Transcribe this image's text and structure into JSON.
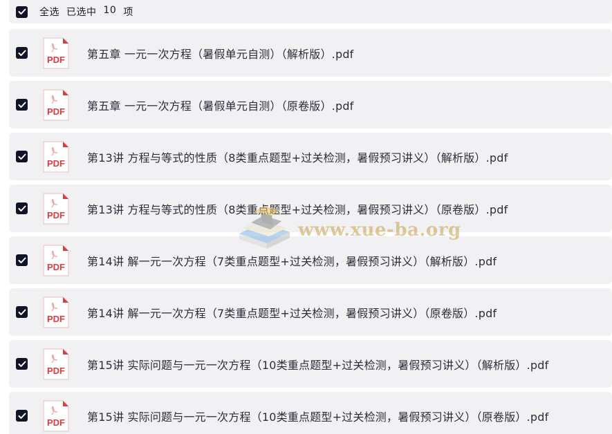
{
  "select_all": {
    "label": "全选",
    "selected_prefix": "已选中",
    "selected_count": "10",
    "selected_suffix": "项",
    "checked": true
  },
  "files": [
    {
      "name": "第五章 一元一次方程（暑假单元自测）（解析版）.pdf",
      "checked": true,
      "icon": "pdf-file-icon"
    },
    {
      "name": "第五章 一元一次方程（暑假单元自测）（原卷版）.pdf",
      "checked": true,
      "icon": "pdf-file-icon"
    },
    {
      "name": "第13讲 方程与等式的性质（8类重点题型+过关检测，暑假预习讲义）（解析版）.pdf",
      "checked": true,
      "icon": "pdf-file-icon"
    },
    {
      "name": "第13讲 方程与等式的性质（8类重点题型+过关检测，暑假预习讲义）（原卷版）.pdf",
      "checked": true,
      "icon": "pdf-file-icon"
    },
    {
      "name": "第14讲 解一元一次方程（7类重点题型+过关检测，暑假预习讲义）（解析版）.pdf",
      "checked": true,
      "icon": "pdf-file-icon"
    },
    {
      "name": "第14讲 解一元一次方程（7类重点题型+过关检测，暑假预习讲义）（原卷版）.pdf",
      "checked": true,
      "icon": "pdf-file-icon"
    },
    {
      "name": "第15讲 实际问题与一元一次方程（10类重点题型+过关检测，暑假预习讲义）（解析版）.pdf",
      "checked": true,
      "icon": "pdf-file-icon"
    },
    {
      "name": "第15讲 实际问题与一元一次方程（10类重点题型+过关检测，暑假预习讲义）（原卷版）.pdf",
      "checked": true,
      "icon": "pdf-file-icon"
    }
  ],
  "pdf_icon_label": "PDF",
  "watermark": {
    "text": "www.xue-ba.org"
  },
  "colors": {
    "checkbox": "#111327",
    "row_background": "#f1f1f3",
    "pdf_red": "#e0393e",
    "watermark_gold": "#c9a04a"
  }
}
